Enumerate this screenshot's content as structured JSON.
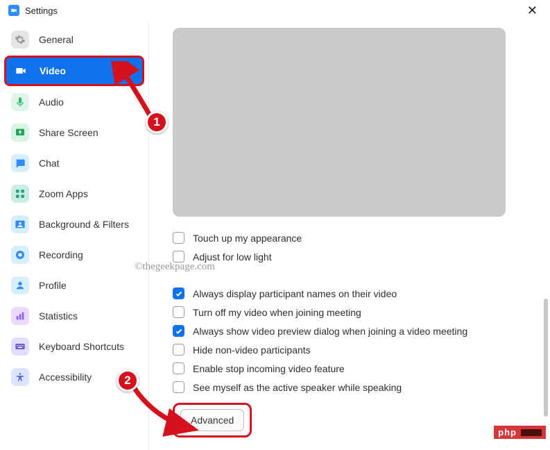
{
  "titlebar": {
    "title": "Settings"
  },
  "sidebar": {
    "items": [
      {
        "label": "General",
        "icon": "gear",
        "bg": "#e5e5e5",
        "fg": "#9a9a9a"
      },
      {
        "label": "Video",
        "icon": "video",
        "bg": "#ffffff",
        "fg": "#0e72ed",
        "active": true
      },
      {
        "label": "Audio",
        "icon": "audio",
        "bg": "#def7e9",
        "fg": "#2bb673"
      },
      {
        "label": "Share Screen",
        "icon": "share",
        "bg": "#d7f5e3",
        "fg": "#23a559"
      },
      {
        "label": "Chat",
        "icon": "chat",
        "bg": "#d7eefc",
        "fg": "#2d8cff"
      },
      {
        "label": "Zoom Apps",
        "icon": "apps",
        "bg": "#c9ede0",
        "fg": "#1fa387"
      },
      {
        "label": "Background & Filters",
        "icon": "bg",
        "bg": "#d7eefc",
        "fg": "#2d8cff"
      },
      {
        "label": "Recording",
        "icon": "rec",
        "bg": "#d7eefc",
        "fg": "#2d8cff"
      },
      {
        "label": "Profile",
        "icon": "profile",
        "bg": "#d7eefc",
        "fg": "#2d8cff"
      },
      {
        "label": "Statistics",
        "icon": "stats",
        "bg": "#eadafb",
        "fg": "#8b5cf6"
      },
      {
        "label": "Keyboard Shortcuts",
        "icon": "keyboard",
        "bg": "#e3dcff",
        "fg": "#6a5acd"
      },
      {
        "label": "Accessibility",
        "icon": "access",
        "bg": "#dde4ff",
        "fg": "#5b6ee1"
      }
    ]
  },
  "content": {
    "checks1": [
      {
        "label": "Touch up my appearance",
        "checked": false
      },
      {
        "label": "Adjust for low light",
        "checked": false
      }
    ],
    "checks2": [
      {
        "label": "Always display participant names on their video",
        "checked": true
      },
      {
        "label": "Turn off my video when joining meeting",
        "checked": false
      },
      {
        "label": "Always show video preview dialog when joining a video meeting",
        "checked": true
      },
      {
        "label": "Hide non-video participants",
        "checked": false
      },
      {
        "label": "Enable stop incoming video feature",
        "checked": false
      },
      {
        "label": "See myself as the active speaker while speaking",
        "checked": false
      }
    ],
    "advanced_label": "Advanced"
  },
  "annotations": {
    "badge1": "1",
    "badge2": "2"
  },
  "watermark": "©thegeekpage.com",
  "footer_badge": "php"
}
